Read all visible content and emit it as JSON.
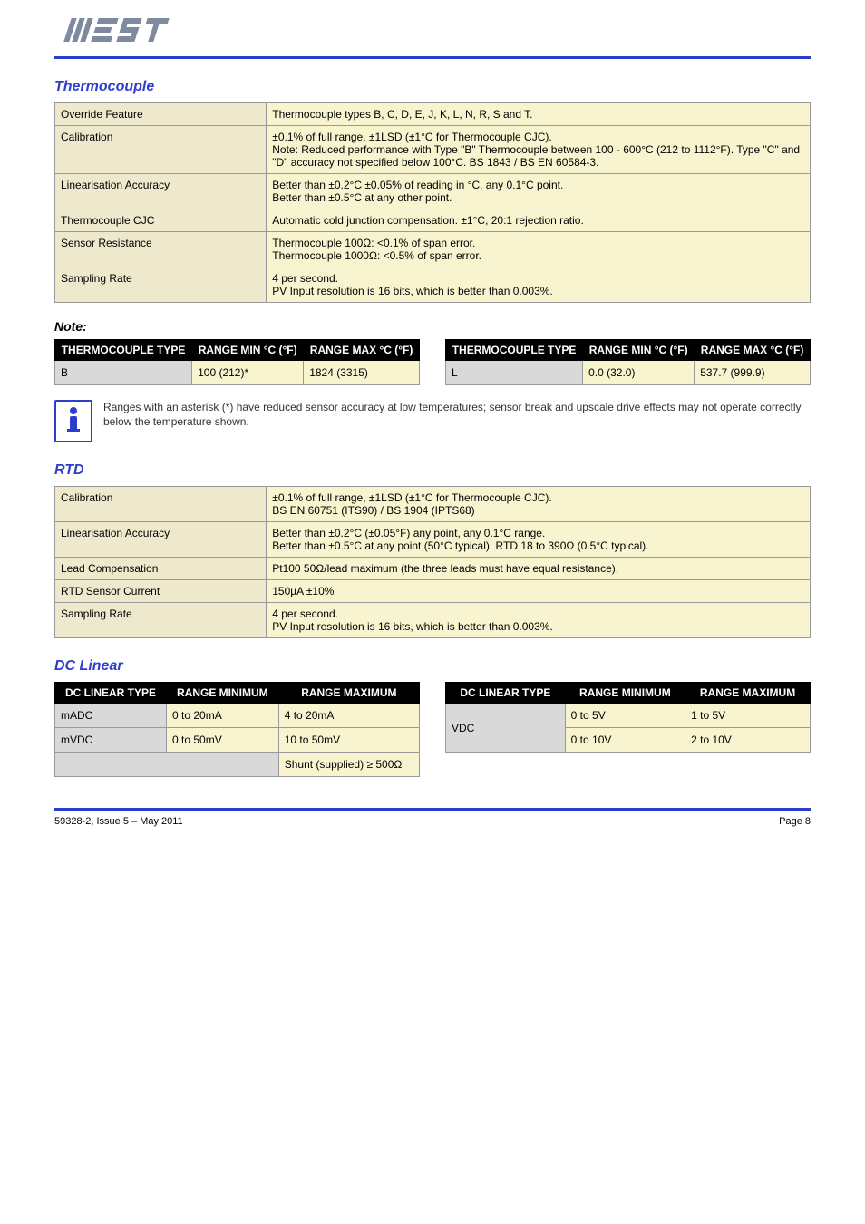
{
  "header": {
    "logo_text": "WEST"
  },
  "section_tc": {
    "title": "Thermocouple",
    "rows": [
      {
        "label": "Override Feature",
        "value": "Thermocouple types B, C, D, E, J, K, L, N, R, S and T."
      },
      {
        "label": "Calibration",
        "value": "±0.1% of full range, ±1LSD (±1°C for Thermocouple CJC).\nNote: Reduced performance with Type \"B\" Thermocouple between 100 - 600°C (212 to 1112°F). Type \"C\" and \"D\" accuracy not specified below 100°C. BS 1843 / BS EN 60584-3."
      },
      {
        "label": "Linearisation Accuracy",
        "value": "Better than ±0.2°C ±0.05% of reading in °C, any 0.1°C point.\nBetter than ±0.5°C at any other point."
      },
      {
        "label": "Thermocouple CJC",
        "value": "Automatic cold junction compensation. ±1°C, 20:1 rejection ratio."
      },
      {
        "label": "Sensor Resistance",
        "value": "Thermocouple 100Ω: <0.1% of span error.\nThermocouple 1000Ω: <0.5% of span error."
      },
      {
        "label": "Sampling Rate",
        "value": "4 per second.\nPV Input resolution is 16 bits, which is better than 0.003%."
      }
    ],
    "note": "Note:",
    "tables_title": "",
    "left_table": {
      "headers": [
        "THERMOCOUPLE TYPE",
        "RANGE MIN °C (°F)",
        "RANGE MAX °C (°F)"
      ],
      "row": [
        "B",
        "100 (212)*",
        "1824 (3315)"
      ]
    },
    "right_table": {
      "headers": [
        "THERMOCOUPLE TYPE",
        "RANGE MIN °C (°F)",
        "RANGE MAX °C (°F)"
      ],
      "row": [
        "L",
        "0.0 (32.0)",
        "537.7 (999.9)"
      ]
    },
    "info_note": "Ranges with an asterisk (*) have reduced sensor accuracy at low temperatures; sensor break and upscale drive effects may not operate correctly below the temperature shown."
  },
  "section_rtd": {
    "title": "RTD",
    "rows": [
      {
        "label": "Calibration",
        "value": "±0.1% of full range, ±1LSD (±1°C for Thermocouple CJC).\nBS EN 60751 (ITS90) / BS 1904 (IPTS68)"
      },
      {
        "label": "Linearisation Accuracy",
        "value": "Better than ±0.2°C (±0.05°F) any point, any 0.1°C range.\nBetter than ±0.5°C at any point (50°C typical). RTD 18 to 390Ω (0.5°C typical)."
      },
      {
        "label": "Lead Compensation",
        "value": "Pt100 50Ω/lead maximum (the three leads must have equal resistance)."
      },
      {
        "label": "RTD Sensor Current",
        "value": "150µA ±10%"
      },
      {
        "label": "Sampling Rate",
        "value": "4 per second.\nPV Input resolution is 16 bits, which is better than 0.003%."
      }
    ]
  },
  "section_dclinear": {
    "title": "DC Linear",
    "left": {
      "headers": [
        "DC LINEAR TYPE",
        "RANGE MINIMUM",
        "RANGE MAXIMUM"
      ],
      "rows": [
        [
          "mADC",
          "0 to 20mA",
          "4 to 20mA"
        ],
        [
          "mVDC",
          "0 to 50mV",
          "10 to 50mV"
        ]
      ],
      "footer": "Shunt (supplied) ≥ 500Ω"
    },
    "right": {
      "headers": [
        "DC LINEAR TYPE",
        "RANGE MINIMUM",
        "RANGE MAXIMUM"
      ],
      "rows": [
        [
          "VDC",
          "0 to 5V",
          "1 to 5V"
        ],
        [
          "",
          "0 to 10V",
          "2 to 10V"
        ]
      ]
    }
  },
  "footer": {
    "left": "59328-2, Issue 5 – May 2011",
    "right": "Page 8"
  }
}
